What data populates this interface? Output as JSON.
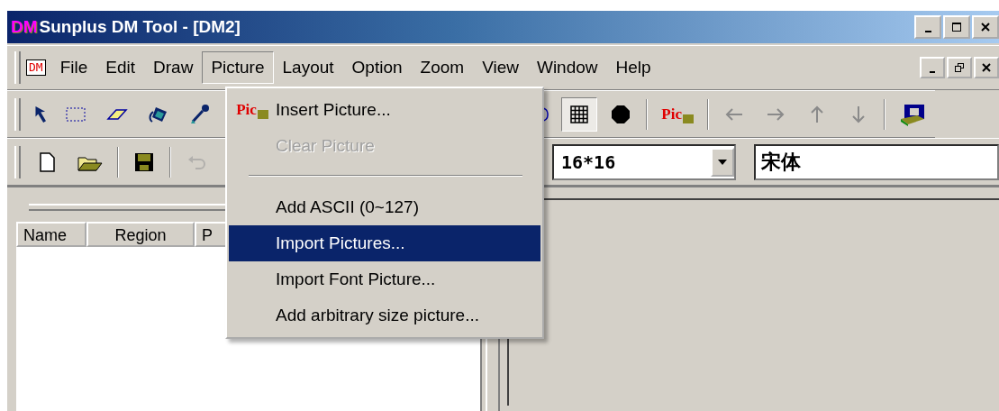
{
  "title_bar": {
    "logo": "DM",
    "title": "Sunplus DM Tool - [DM2]"
  },
  "menu_bar": {
    "doc_icon_text": "DM",
    "items": [
      {
        "label": "File",
        "selected": false
      },
      {
        "label": "Edit",
        "selected": false
      },
      {
        "label": "Draw",
        "selected": false
      },
      {
        "label": "Picture",
        "selected": true
      },
      {
        "label": "Layout",
        "selected": false
      },
      {
        "label": "Option",
        "selected": false
      },
      {
        "label": "Zoom",
        "selected": false
      },
      {
        "label": "View",
        "selected": false
      },
      {
        "label": "Window",
        "selected": false
      },
      {
        "label": "Help",
        "selected": false
      }
    ]
  },
  "picture_menu": [
    {
      "kind": "item",
      "label": "Insert Picture...",
      "icon_text": "Pic",
      "disabled": false,
      "selected": false
    },
    {
      "kind": "item",
      "label": "Clear Picture",
      "disabled": true,
      "selected": false
    },
    {
      "kind": "separator"
    },
    {
      "kind": "item",
      "label": "Add ASCII (0~127)",
      "disabled": false,
      "selected": false
    },
    {
      "kind": "item",
      "label": "Import Pictures...",
      "disabled": false,
      "selected": true
    },
    {
      "kind": "item",
      "label": "Import Font Picture...",
      "disabled": false,
      "selected": false
    },
    {
      "kind": "item",
      "label": "Add arbitrary size picture...",
      "disabled": false,
      "selected": false
    }
  ],
  "toolbar_1": {
    "tools_left": [
      {
        "kind": "pointer",
        "pressed": false
      },
      {
        "kind": "select",
        "pressed": false
      },
      {
        "kind": "eraser",
        "pressed": false
      },
      {
        "kind": "fill",
        "pressed": false
      },
      {
        "kind": "dropper",
        "pressed": false
      }
    ],
    "tools_right": [
      {
        "kind": "rounded-rect",
        "pressed": false
      },
      {
        "kind": "grid",
        "pressed": true
      },
      {
        "kind": "octagon",
        "pressed": false
      },
      {
        "kind": "separator"
      },
      {
        "kind": "pic",
        "label": "Pic",
        "pressed": false
      },
      {
        "kind": "separator"
      },
      {
        "kind": "left",
        "pressed": false
      },
      {
        "kind": "right",
        "pressed": false
      },
      {
        "kind": "up",
        "pressed": false
      },
      {
        "kind": "down",
        "pressed": false
      },
      {
        "kind": "separator"
      },
      {
        "kind": "image",
        "pressed": false
      }
    ]
  },
  "toolbar_2": {
    "tools": [
      {
        "kind": "new",
        "disabled": false
      },
      {
        "kind": "open",
        "disabled": false
      },
      {
        "kind": "separator"
      },
      {
        "kind": "save",
        "disabled": false
      },
      {
        "kind": "separator"
      },
      {
        "kind": "undo",
        "disabled": true
      }
    ],
    "size_combo": {
      "value": "16*16"
    },
    "font_field": {
      "value": "宋体"
    }
  },
  "list": {
    "columns": [
      "Name",
      "Region",
      "P"
    ]
  }
}
